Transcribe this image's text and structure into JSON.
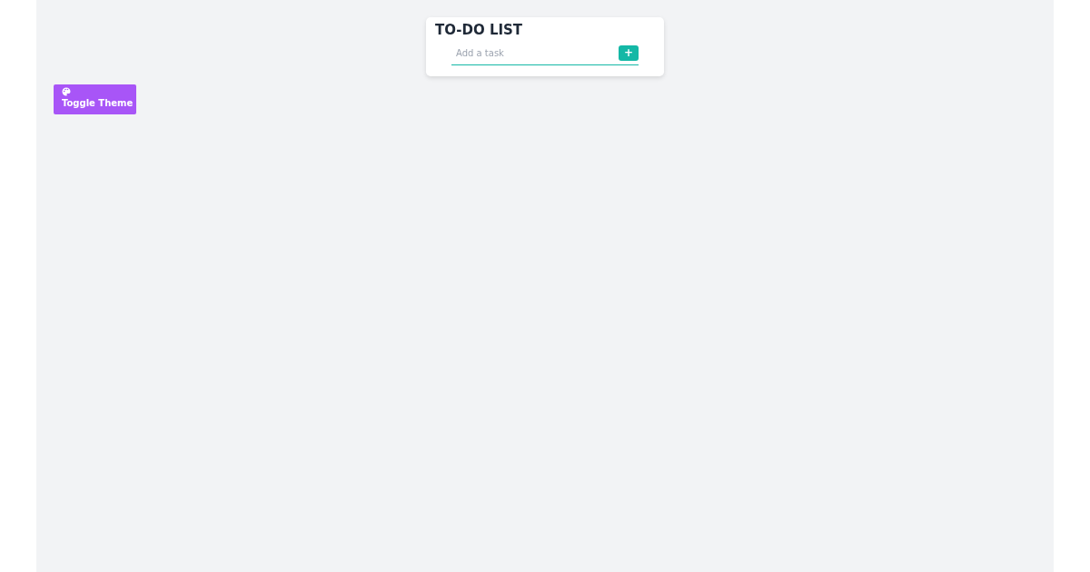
{
  "title": "TO-DO LIST",
  "task_input": {
    "placeholder": "Add a task"
  },
  "add_button": {
    "label": "+"
  },
  "theme_button": {
    "label": "Toggle Theme"
  }
}
